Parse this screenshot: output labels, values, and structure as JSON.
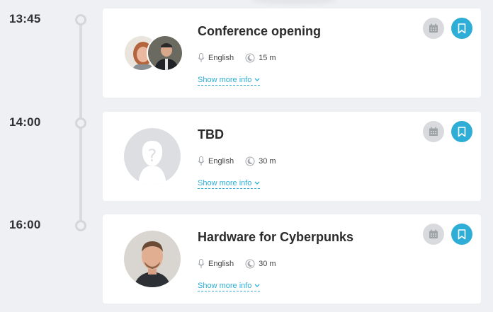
{
  "schedule": [
    {
      "time": "13:45",
      "title": "Conference opening",
      "language": "English",
      "duration": "15 m",
      "more_label": "Show more info",
      "speaker_count": 2
    },
    {
      "time": "14:00",
      "title": "TBD",
      "language": "English",
      "duration": "30 m",
      "more_label": "Show more info",
      "speaker_count": 1
    },
    {
      "time": "16:00",
      "title": "Hardware for Cyberpunks",
      "language": "English",
      "duration": "30 m",
      "more_label": "Show more info",
      "speaker_count": 1
    }
  ],
  "icons": {
    "language": "microphone-icon",
    "duration": "moon-clock-icon",
    "calendar": "calendar-icon",
    "bookmark": "bookmark-icon",
    "expand": "chevron-down-icon"
  },
  "colors": {
    "accent": "#2eaed6",
    "calendar_button": "#d8dadd",
    "timeline": "#d9dbdf",
    "background": "#eef0f3"
  }
}
